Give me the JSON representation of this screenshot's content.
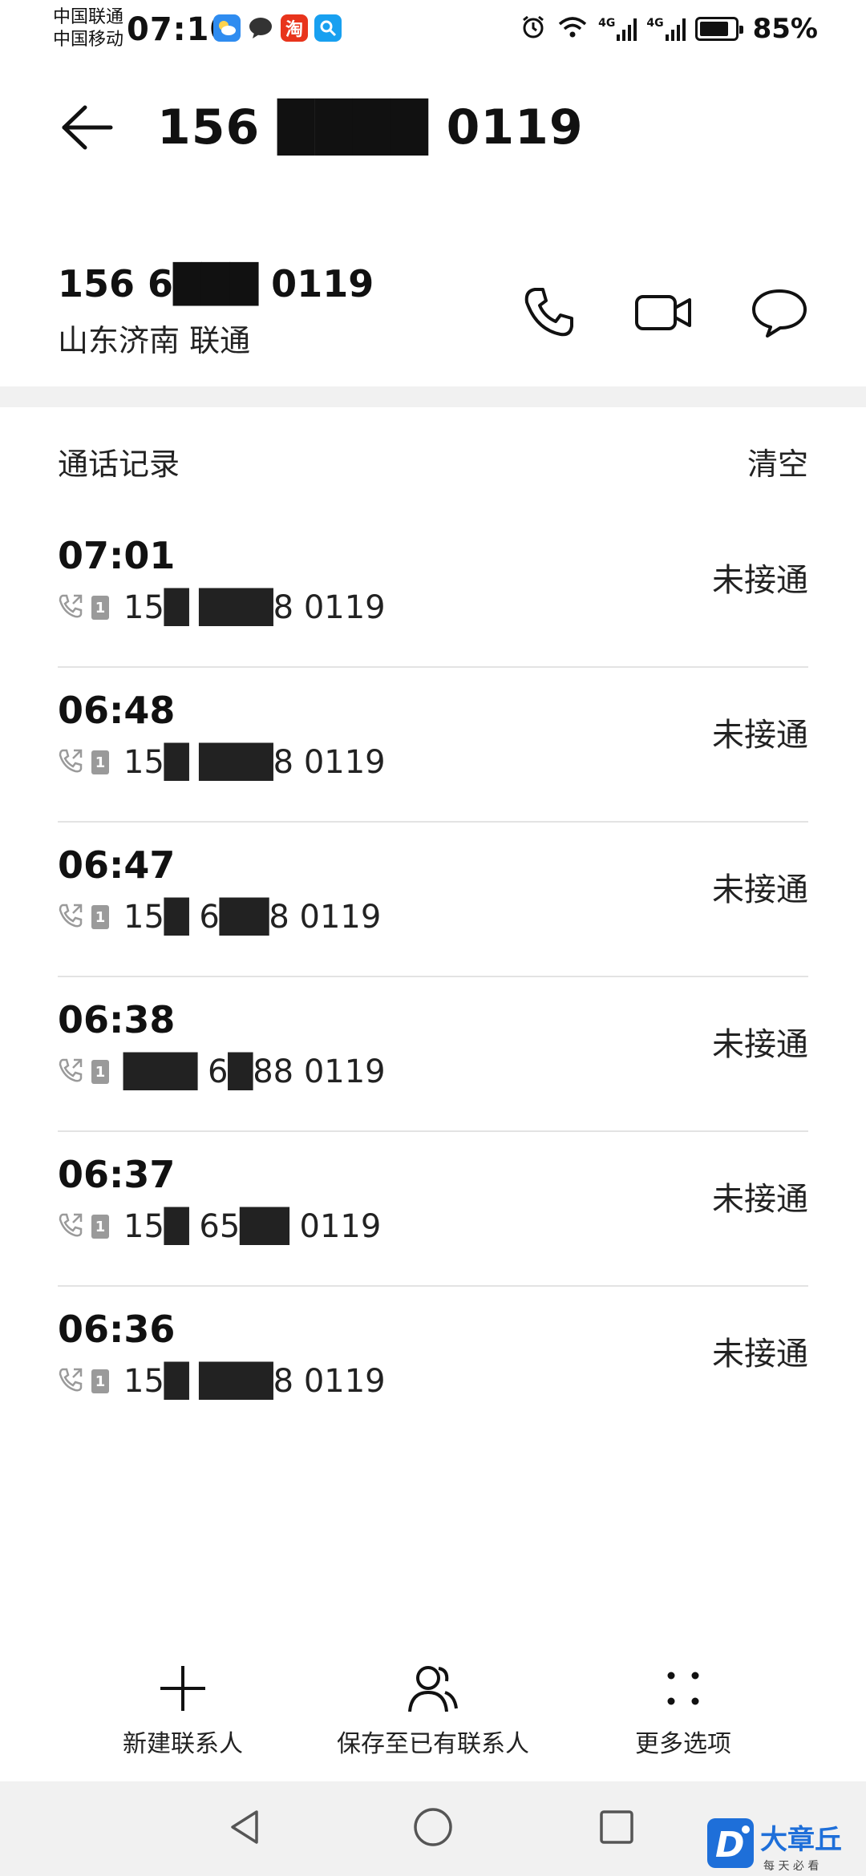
{
  "status_bar": {
    "carrier_1": "中国联通",
    "carrier_2": "中国移动",
    "time": "07:10",
    "app_icons": [
      "weather-icon",
      "chat-bubble-icon",
      "taobao-icon",
      "search-app-icon"
    ],
    "taobao_glyph": "淘",
    "network_1": "4G",
    "network_2": "4G",
    "battery_percent_text": "85%",
    "battery_level": 0.85
  },
  "header": {
    "title": "156 ████ 0119"
  },
  "contact": {
    "number": "156 6███ 0119",
    "location": "山东济南 联通",
    "actions": [
      "phone-icon",
      "video-call-icon",
      "message-icon"
    ]
  },
  "call_log": {
    "title": "通话记录",
    "clear_label": "清空",
    "entries": [
      {
        "time": "07:01",
        "number": "15█ ███8 0119",
        "status": "未接通"
      },
      {
        "time": "06:48",
        "number": "15█ ███8 0119",
        "status": "未接通"
      },
      {
        "time": "06:47",
        "number": "15█ 6██8 0119",
        "status": "未接通"
      },
      {
        "time": "06:38",
        "number": "███ 6█88 0119",
        "status": "未接通"
      },
      {
        "time": "06:37",
        "number": "15█ 65██ 0119",
        "status": "未接通"
      },
      {
        "time": "06:36",
        "number": "15█ ███8 0119",
        "status": "未接通"
      }
    ],
    "sim_label": "1"
  },
  "bottom_actions": {
    "new_contact": "新建联系人",
    "save_to_existing": "保存至已有联系人",
    "more_options": "更多选项"
  },
  "nav_bar": {
    "buttons": [
      "back-triangle-icon",
      "home-circle-icon",
      "recents-square-icon"
    ]
  },
  "watermark": {
    "brand": "大章丘",
    "tagline": "每 天 必 看"
  },
  "colors": {
    "text": "#111111",
    "divider": "#e3e3e3",
    "band": "#f1f1f1"
  }
}
